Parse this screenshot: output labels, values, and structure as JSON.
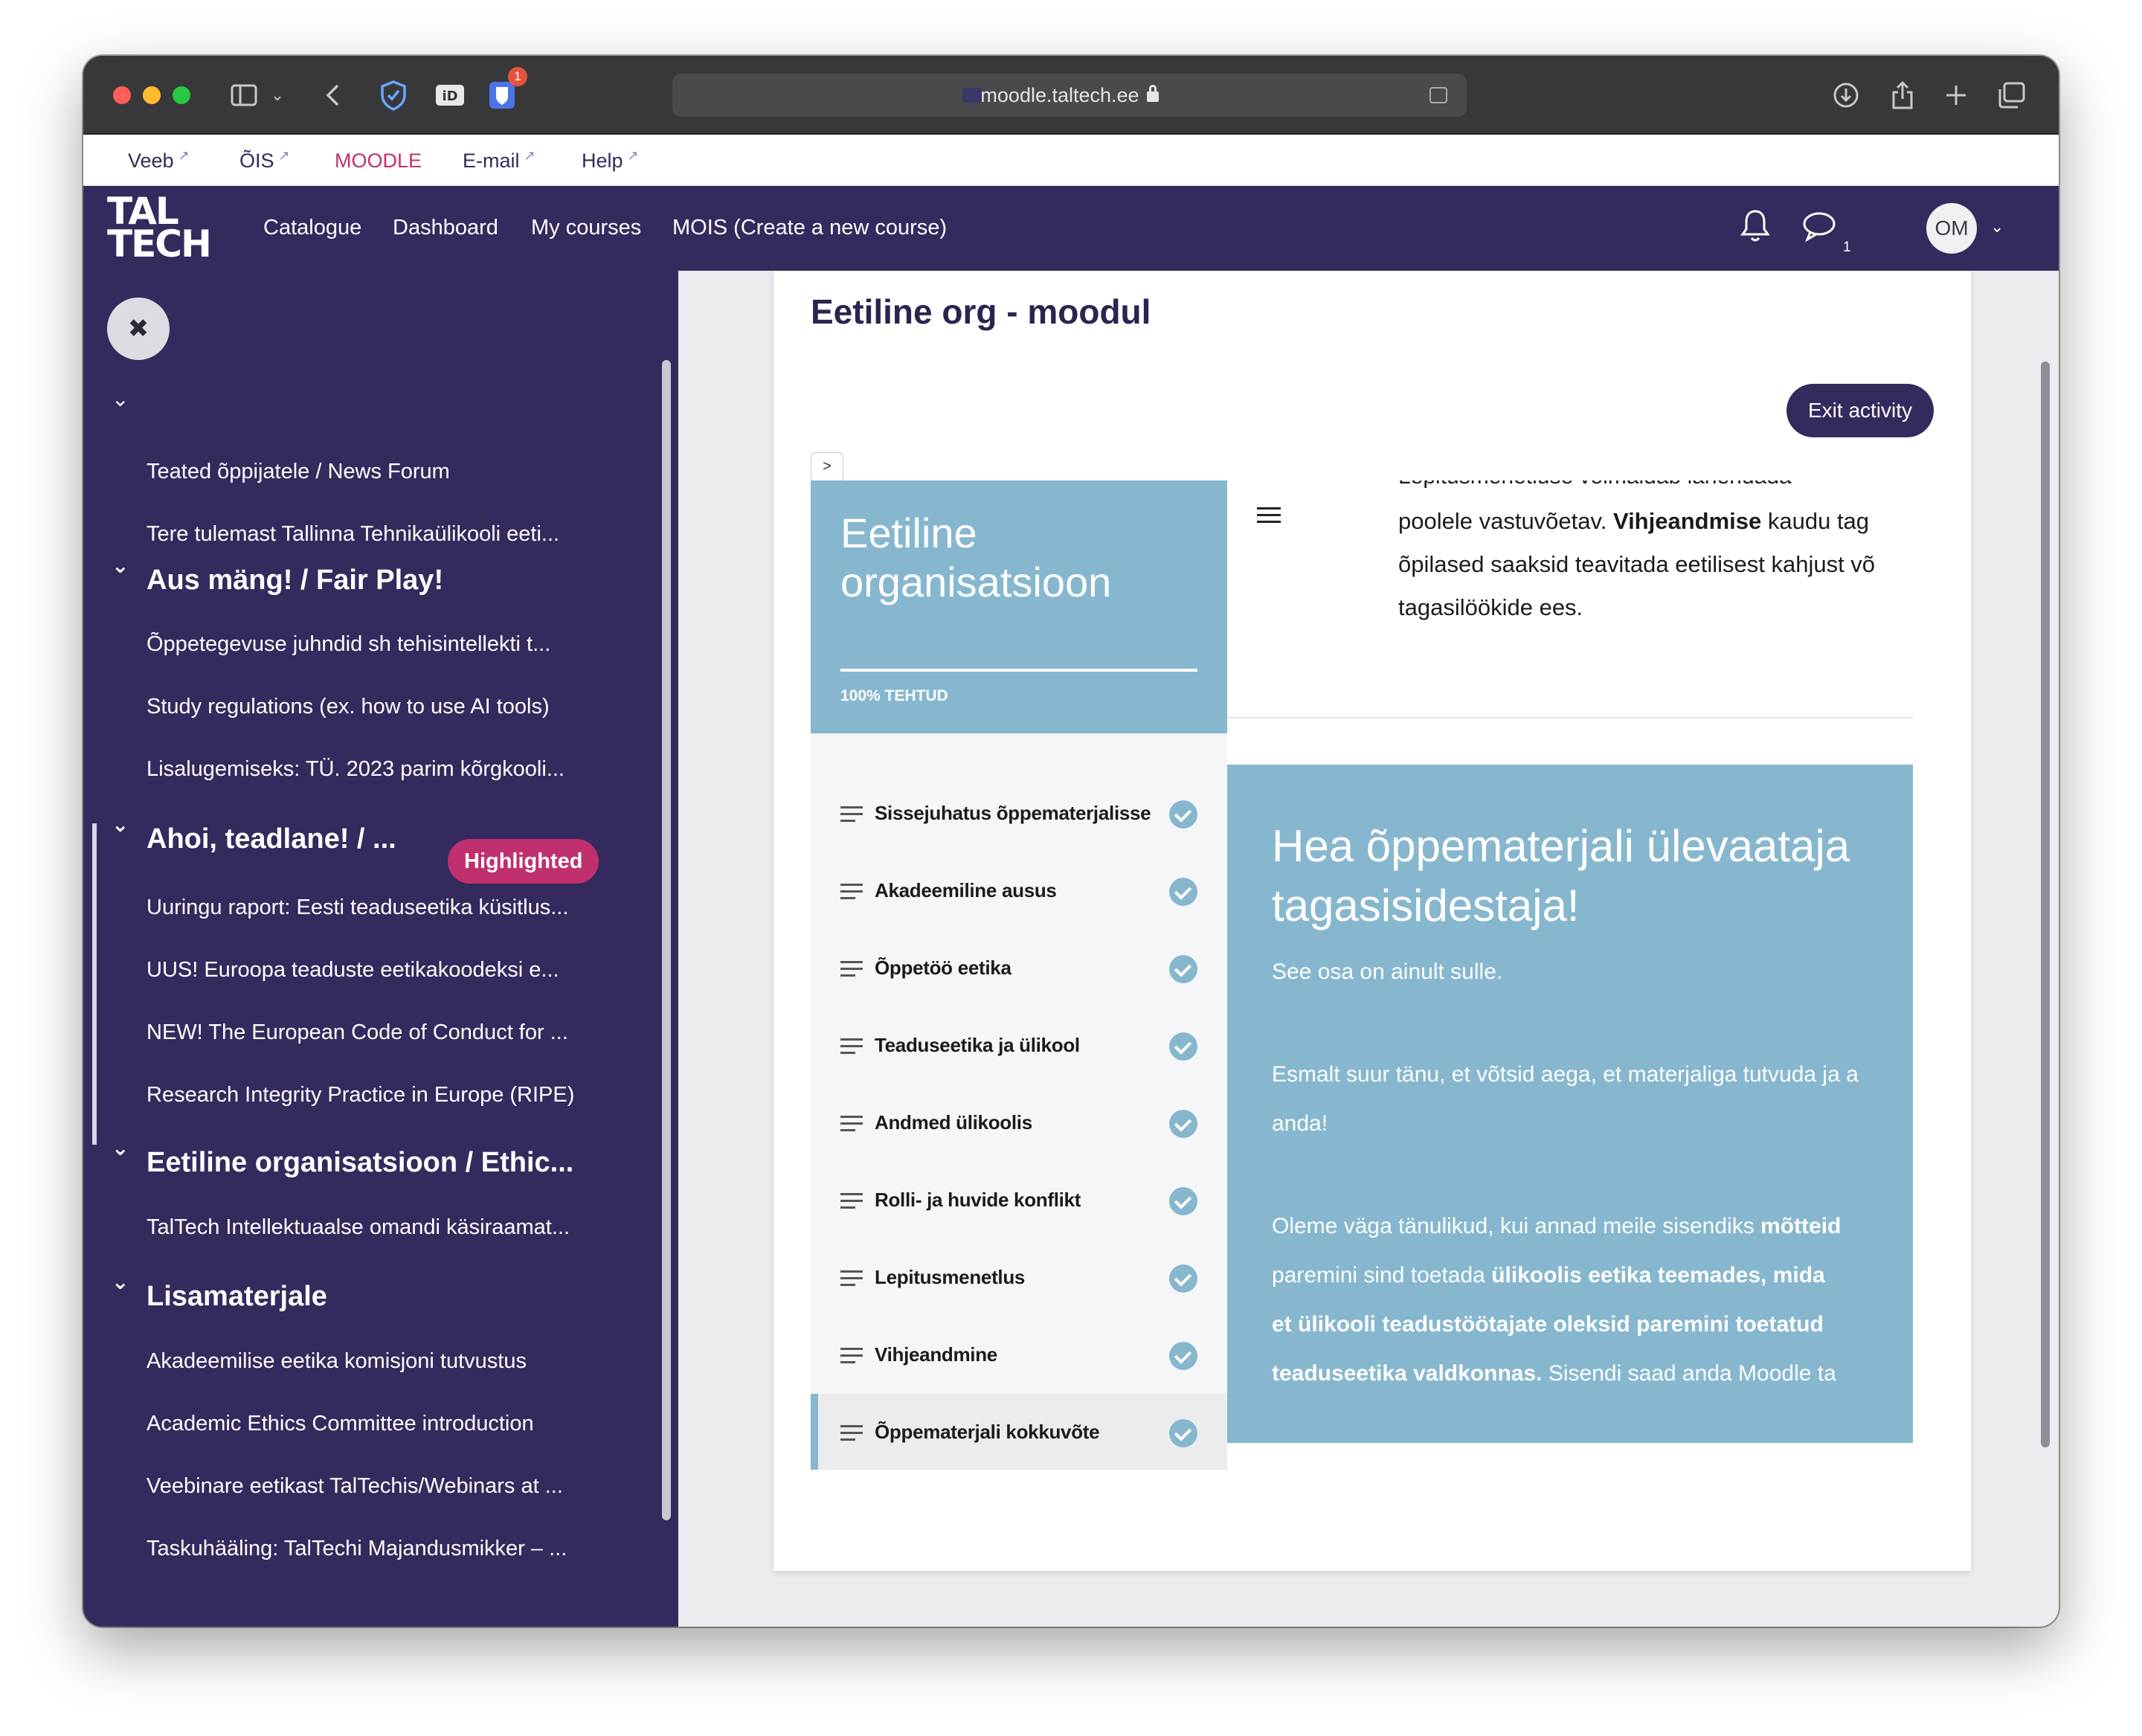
{
  "browser": {
    "url": "moodle.taltech.ee",
    "notification_badge": "1"
  },
  "toplinks": [
    {
      "label": "Veeb"
    },
    {
      "label": "ÕIS"
    },
    {
      "label": "MOODLE"
    },
    {
      "label": "E-mail"
    },
    {
      "label": "Help"
    }
  ],
  "navbar": {
    "logo_line1": "TAL",
    "logo_line2": "TECH",
    "links": [
      "Catalogue",
      "Dashboard",
      "My courses",
      "MOIS (Create a new course)"
    ],
    "message_count": "1",
    "avatar_initials": "OM"
  },
  "sidebar": {
    "close_label": "✖",
    "items": [
      "Teated õppijatele / News Forum",
      "Tere tulemast Tallinna Tehnikaülikooli eeti...",
      "Õppetegevuse juhndid sh tehisintellekti t...",
      "Study regulations (ex. how to use AI tools)",
      "Lisalugemiseks: TÜ. 2023 parim kõrgkooli...",
      "Uuringu raport: Eesti teaduseetika küsitlus...",
      "UUS! Euroopa teaduste eetikakoodeksi e...",
      "NEW! The European Code of Conduct for ...",
      "Research Integrity Practice in Europe (RIPE)",
      "TalTech Intellektuaalse omandi käsiraamat...",
      "Akadeemilise eetika komisjoni tutvustus",
      "Academic Ethics Committee introduction",
      "Veebinare eetikast TalTechis/Webinars at ...",
      "Taskuhääling: TalTechi Majandusmikker – ..."
    ],
    "sections": [
      "Aus mäng! / Fair Play!",
      "Ahoi, teadlane! / ...",
      "Eetiline organisatsioon / Ethic...",
      "Lisamaterjale"
    ],
    "highlight_badge": "Highlighted"
  },
  "main": {
    "page_title": "Eetiline org - moodul",
    "exit_button": "Exit activity",
    "toggle_label": ">"
  },
  "lesson": {
    "title": "Eetiline organisatsioon",
    "progress_label": "100% TEHTUD",
    "progress_fraction": 1.0,
    "menu": [
      "Sissejuhatus õppematerjalisse",
      "Akadeemiline ausus",
      "Õppetöö eetika",
      "Teaduseetika ja ülikool",
      "Andmed ülikoolis",
      "Rolli- ja huvide konflikt",
      "Lepitusmenetlus",
      "Vihjeandmine",
      "Õppematerjali kokkuvõte"
    ],
    "content": {
      "cutoff_top": "Lepitusmenetluse võimaldab lahendada",
      "line1_a": "poolele vastuvõetav. ",
      "line1_b": "Vihjeandmise",
      "line1_c": " kaudu tag",
      "line2": "õpilased saaksid teavitada eetilisest kahjust võ",
      "line3": "tagasilöökide ees."
    },
    "feedback": {
      "title_line1": "Hea õppematerjali ülevaataja",
      "title_line2": "tagasisidestaja!",
      "subtitle": "See osa on ainult sulle.",
      "p1_line1": "Esmalt suur tänu, et võtsid aega, et materjaliga tutvuda ja a",
      "p1_line2": "anda!",
      "p2_line1_a": "Oleme väga tänulikud, kui annad meile sisendiks ",
      "p2_line1_b": "mõtteid",
      "p2_line2_a": "paremini sind toetada ",
      "p2_line2_b": "ülikoolis eetika teemades, mida",
      "p2_line3": "et ülikooli teadustöötajate oleksid paremini toetatud",
      "p2_line4_a": "teaduseetika valdkonnas.",
      "p2_line4_b": " Sisendi saad anda Moodle ta"
    }
  }
}
